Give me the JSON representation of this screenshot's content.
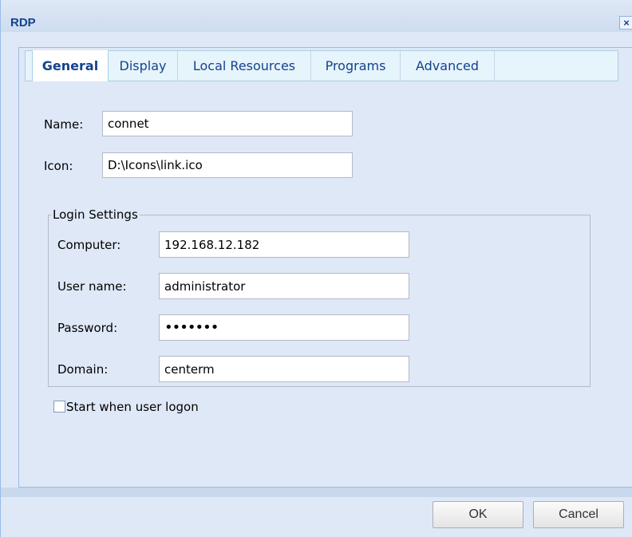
{
  "window": {
    "title": "RDP",
    "close_glyph": "×"
  },
  "tabs": [
    {
      "label": "General",
      "active": true
    },
    {
      "label": "Display",
      "active": false
    },
    {
      "label": "Local Resources",
      "active": false
    },
    {
      "label": "Programs",
      "active": false
    },
    {
      "label": "Advanced",
      "active": false
    }
  ],
  "general": {
    "name_label": "Name:",
    "name_value": "connet",
    "icon_label": "Icon:",
    "icon_value": "D:\\Icons\\link.ico"
  },
  "login": {
    "legend": "Login Settings",
    "computer_label": "Computer:",
    "computer_value": "192.168.12.182",
    "username_label": "User name:",
    "username_value": "administrator",
    "password_label": "Password:",
    "password_value": "•••••••",
    "domain_label": "Domain:",
    "domain_value": "centerm"
  },
  "startup": {
    "label": "Start when user logon",
    "checked": false
  },
  "buttons": {
    "ok": "OK",
    "cancel": "Cancel"
  },
  "colors": {
    "title": "#15428b",
    "background": "#dfe8f6",
    "border": "#99bbe8"
  }
}
